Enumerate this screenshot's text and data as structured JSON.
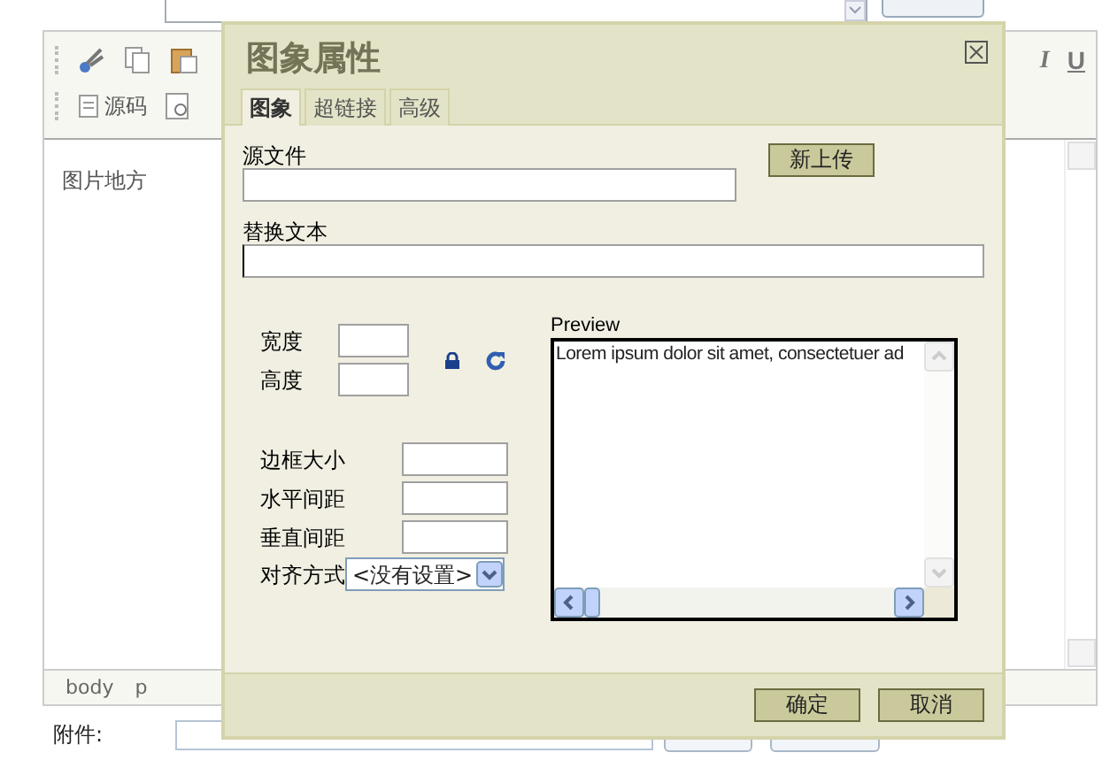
{
  "editor": {
    "source_button": "源码",
    "toolbar_letters": [
      "I",
      "U"
    ],
    "content": "图片地方",
    "status_path": [
      "body",
      "p"
    ]
  },
  "attachment": {
    "label": "附件:"
  },
  "dialog": {
    "title": "图象属性",
    "tabs": [
      {
        "label": "图象",
        "selected": true
      },
      {
        "label": "超链接",
        "selected": false
      },
      {
        "label": "高级",
        "selected": false
      }
    ],
    "source_label": "源文件",
    "upload_button": "新上传",
    "alt_label": "替换文本",
    "size_fields": [
      {
        "label": "宽度"
      },
      {
        "label": "高度"
      }
    ],
    "spacing_fields": [
      {
        "label": "边框大小"
      },
      {
        "label": "水平间距"
      },
      {
        "label": "垂直间距"
      }
    ],
    "align": {
      "label": "对齐方式",
      "value": "<没有设置>"
    },
    "preview": {
      "label": "Preview",
      "text": "Lorem ipsum dolor sit amet, consectetuer ad"
    },
    "buttons": [
      "确定",
      "取消"
    ]
  }
}
